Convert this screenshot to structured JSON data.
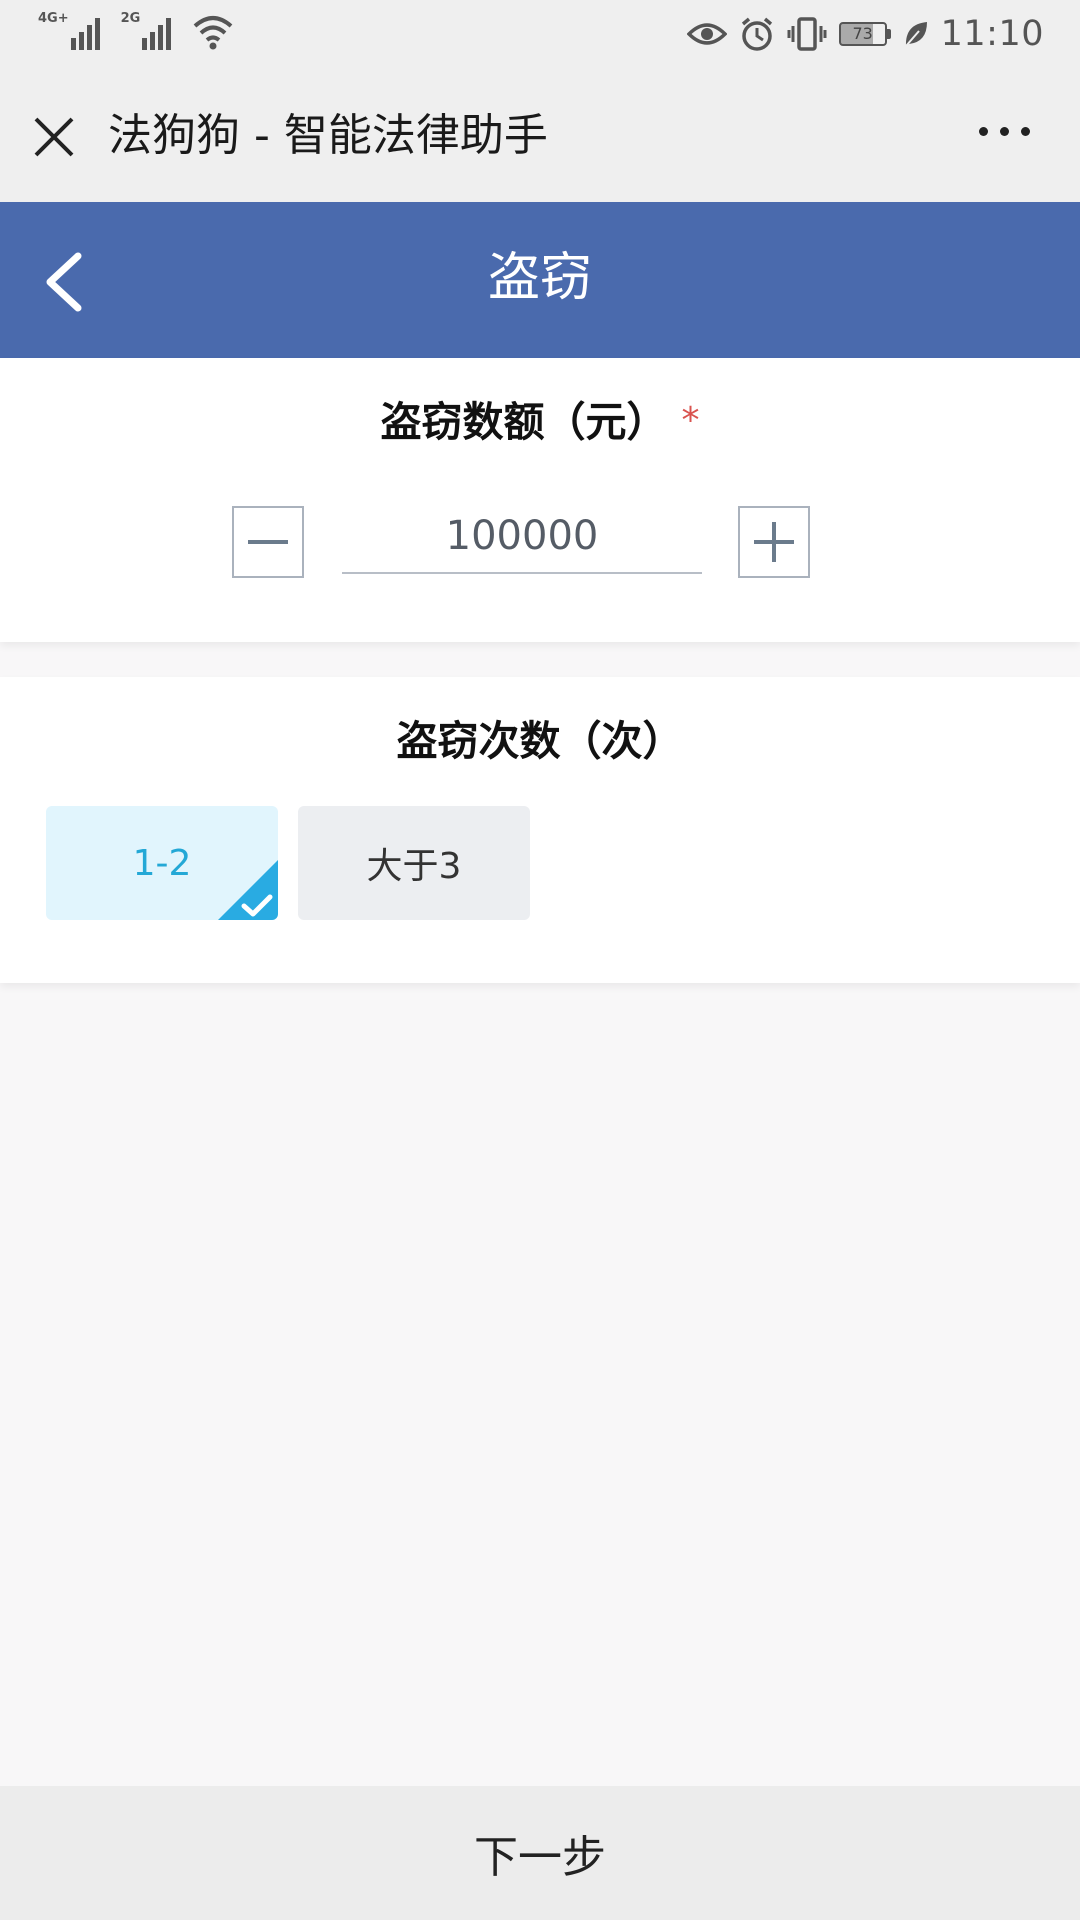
{
  "status_bar": {
    "network_1": "4G",
    "network_1_suffix": "+",
    "network_2": "2G",
    "battery_level": "73",
    "battery_fraction": 0.73,
    "time": "11:10",
    "icons": [
      "signal-icon",
      "signal-icon",
      "wifi-icon",
      "eye-icon",
      "alarm-icon",
      "vibrate-icon",
      "battery-icon",
      "leaf-icon"
    ]
  },
  "webview": {
    "title": "法狗狗 - 智能法律助手",
    "close_icon": "close-icon",
    "more_icon": "more-icon"
  },
  "nav": {
    "title": "盗窃",
    "back_icon": "chevron-left-icon",
    "color": "#4a6aad"
  },
  "amount_section": {
    "label": "盗窃数额（元）",
    "required_mark": "*",
    "value": "100000",
    "minus_icon": "minus-icon",
    "plus_icon": "plus-icon"
  },
  "count_section": {
    "label": "盗窃次数（次）",
    "options": [
      {
        "label": "1-2",
        "selected": true
      },
      {
        "label": "大于3",
        "selected": false
      }
    ],
    "selected_color": "#29abe2"
  },
  "footer": {
    "next_label": "下一步"
  }
}
